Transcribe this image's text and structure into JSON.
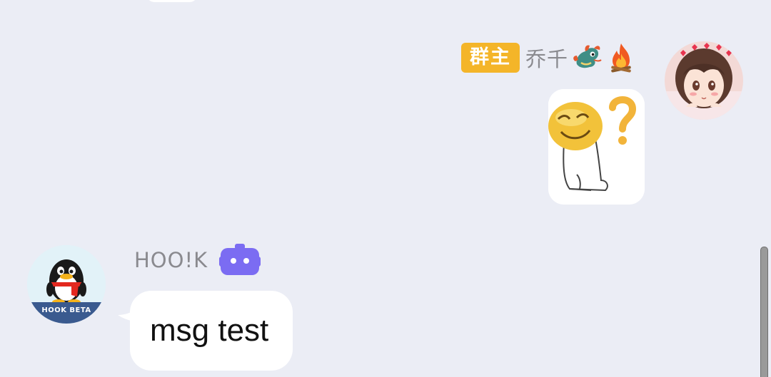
{
  "messages": {
    "outgoing": {
      "role_badge": "群主",
      "sender_name": "乔千",
      "badge_icons": [
        "dragon-icon",
        "fire-icon"
      ],
      "content_type": "sticker",
      "sticker_icon": "confused-face-question-mark"
    },
    "incoming": {
      "sender_name": "HOO!K",
      "avatar_label": "HOOK BETA",
      "bot_icon": "robot-icon",
      "text": "msg test"
    }
  },
  "colors": {
    "background": "#ebedf5",
    "role_badge": "#f4b529",
    "bot_badge": "#7b6cf2",
    "bubble": "#ffffff"
  }
}
